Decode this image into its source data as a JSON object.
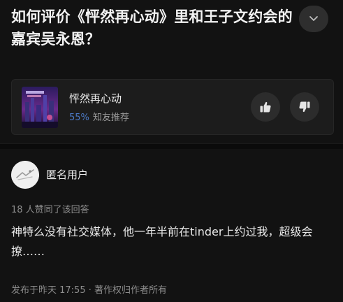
{
  "question": {
    "title": "如何评价《怦然再心动》里和王子文约会的嘉宾吴永恩？"
  },
  "header": {
    "collapse_icon": "chevron-down-icon"
  },
  "show_card": {
    "name": "怦然再心动",
    "rating_percent": "55%",
    "rating_label": "知友推荐",
    "upvote_icon": "thumbs-up-icon",
    "downvote_icon": "thumbs-down-icon",
    "accent_color": "#4b79c6"
  },
  "answer": {
    "author": "匿名用户",
    "agree_text": "18 人赞同了该回答",
    "body": "神特么没有社交媒体，他一年半前在tinder上约过我，超级会撩……",
    "footer": "发布于昨天 17:55 · 著作权归作者所有"
  }
}
